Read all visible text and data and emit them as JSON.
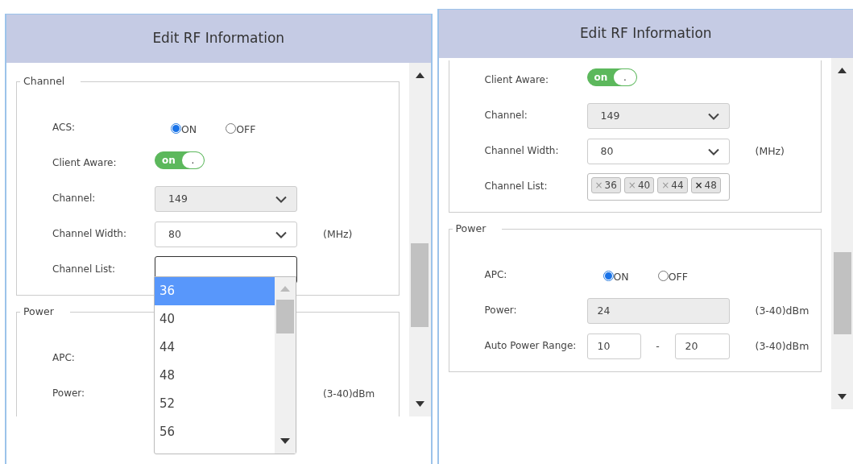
{
  "panels": [
    {
      "kind": "dropdown_open",
      "title": "Edit RF Information",
      "sections": [
        {
          "legend": "Channel",
          "rows": [
            {
              "kind": "radio",
              "label": "ACS:",
              "options": [
                {
                  "label": "ON",
                  "selected": true
                },
                {
                  "label": "OFF",
                  "selected": false
                }
              ]
            },
            {
              "kind": "toggle",
              "label": "Client Aware:",
              "on": true,
              "toggle_text": "on",
              "knob_text": "."
            },
            {
              "kind": "select",
              "label": "Channel:",
              "value": "149",
              "disabled": true
            },
            {
              "kind": "select",
              "label": "Channel Width:",
              "value": "80",
              "disabled": false,
              "unit": "(MHz)"
            },
            {
              "kind": "tags",
              "label": "Channel List:",
              "focused": true,
              "tags": []
            }
          ]
        },
        {
          "legend": "Power",
          "rows": [
            {
              "kind": "plain",
              "label": "APC:"
            },
            {
              "kind": "plain",
              "label": "Power:",
              "unit": "(3-40)dBm"
            }
          ]
        }
      ],
      "dropdown": {
        "options": [
          {
            "label": "36",
            "selected": true
          },
          {
            "label": "40",
            "selected": false
          },
          {
            "label": "44",
            "selected": false
          },
          {
            "label": "48",
            "selected": false
          },
          {
            "label": "52",
            "selected": false
          },
          {
            "label": "56",
            "selected": false
          }
        ]
      }
    },
    {
      "kind": "scrolled",
      "title": "Edit RF Information",
      "sections": [
        {
          "rows": [
            {
              "kind": "toggle",
              "label": "Client Aware:",
              "on": true,
              "toggle_text": "on",
              "knob_text": "."
            },
            {
              "kind": "select",
              "label": "Channel:",
              "value": "149",
              "disabled": true
            },
            {
              "kind": "select",
              "label": "Channel Width:",
              "value": "80",
              "disabled": false,
              "unit": "(MHz)"
            },
            {
              "kind": "tags",
              "label": "Channel List:",
              "focused": false,
              "tags": [
                {
                  "label": "36",
                  "remove": "×",
                  "hovered": false
                },
                {
                  "label": "40",
                  "remove": "×",
                  "hovered": false
                },
                {
                  "label": "44",
                  "remove": "×",
                  "hovered": false
                },
                {
                  "label": "48",
                  "remove": "×",
                  "hovered": true
                }
              ]
            }
          ]
        },
        {
          "legend": "Power",
          "rows": [
            {
              "kind": "radio",
              "label": "APC:",
              "options": [
                {
                  "label": "ON",
                  "selected": true
                },
                {
                  "label": "OFF",
                  "selected": false
                }
              ]
            },
            {
              "kind": "input",
              "label": "Power:",
              "value": "24",
              "disabled": true,
              "unit": "(3-40)dBm"
            },
            {
              "kind": "range",
              "label": "Auto Power Range:",
              "from": "10",
              "separator": "-",
              "to": "20",
              "unit": "(3-40)dBm"
            }
          ]
        }
      ]
    }
  ]
}
